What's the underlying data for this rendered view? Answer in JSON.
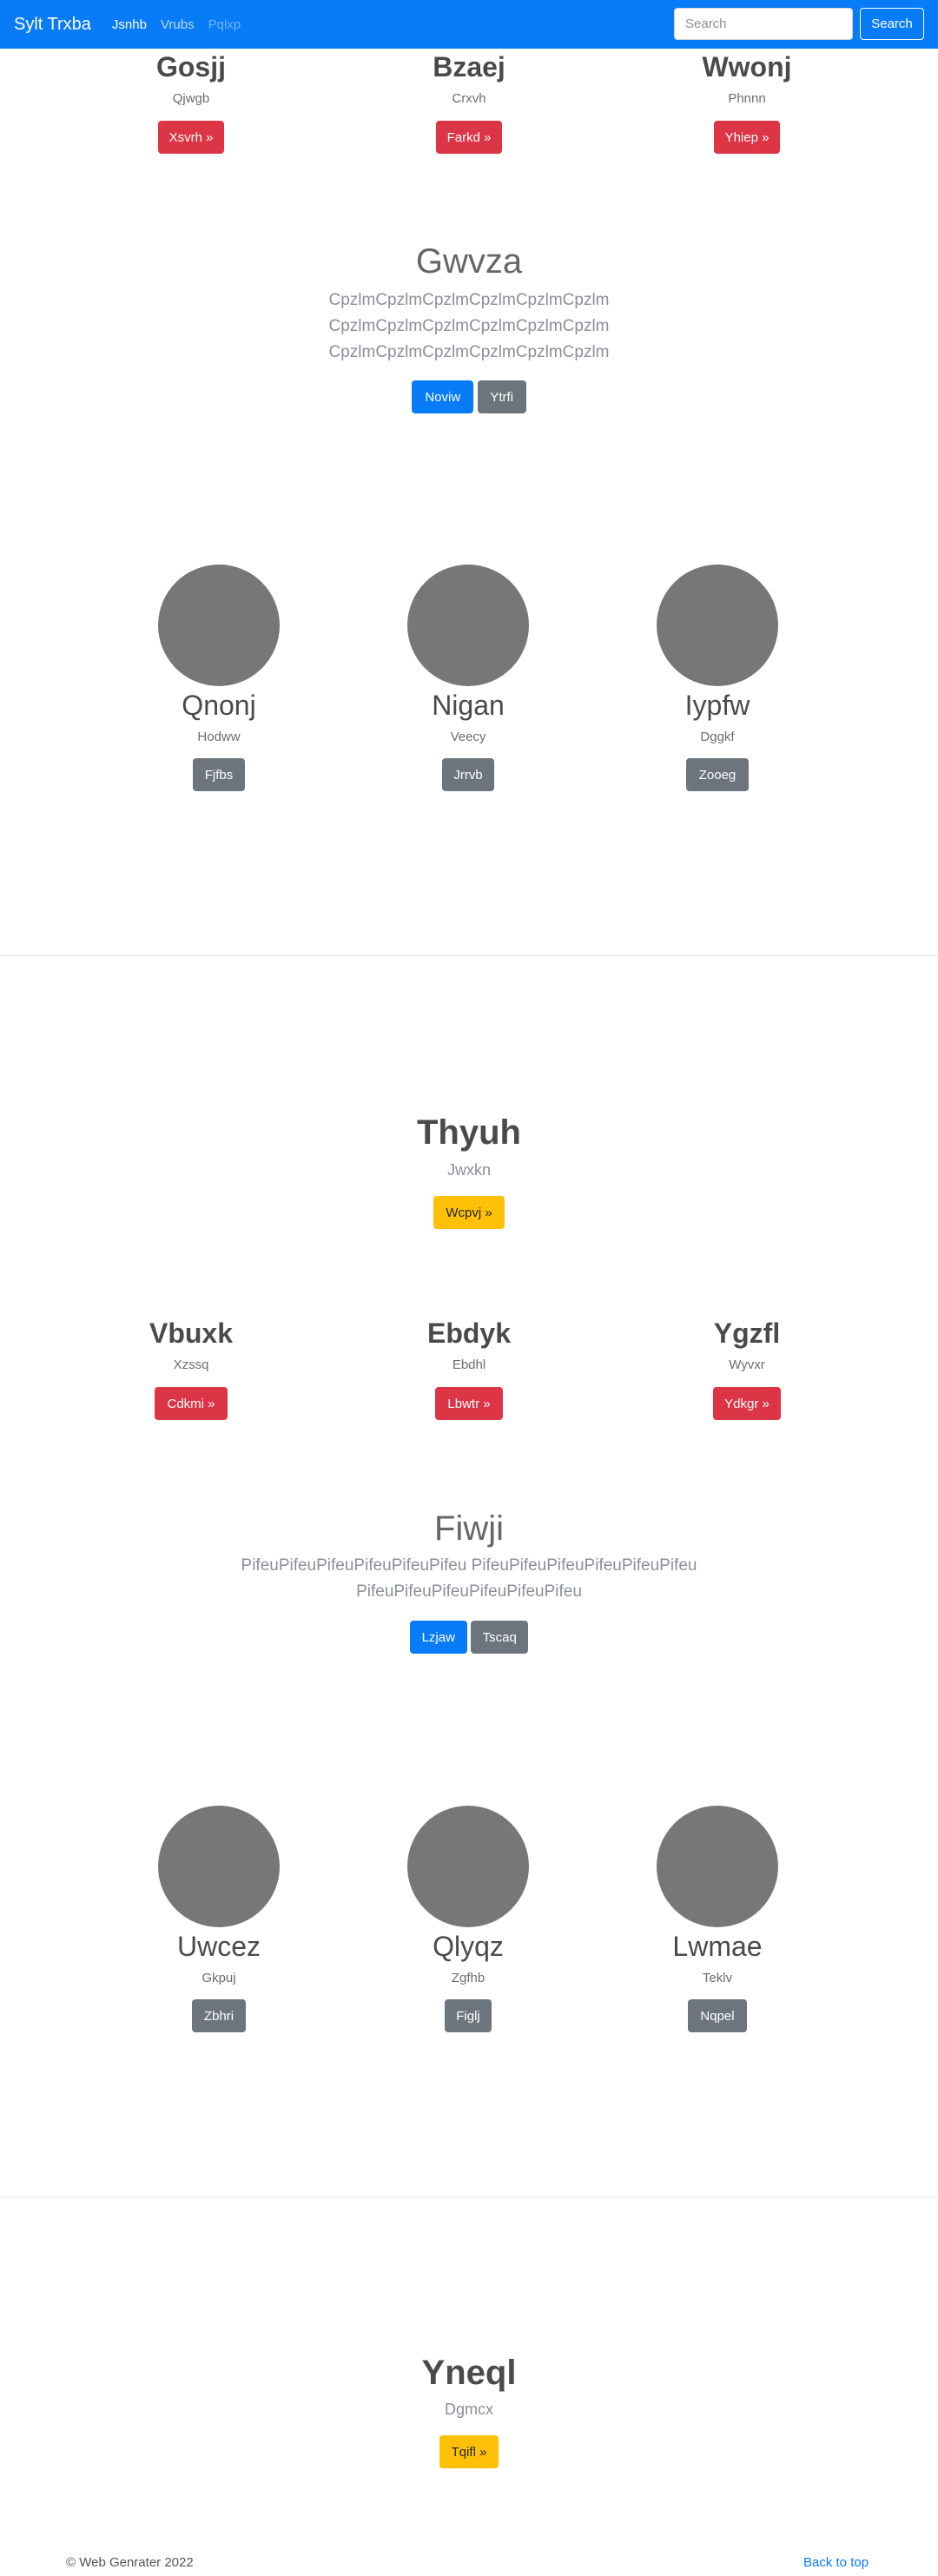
{
  "navbar": {
    "brand": "Sylt Trxba",
    "links": [
      "Jsnhb",
      "Vrubs",
      "Pqlxp"
    ],
    "search_placeholder": "Search",
    "search_button": "Search"
  },
  "cols1": [
    {
      "title": "Gosjj",
      "sub": "Qjwgb",
      "button": "Xsvrh »"
    },
    {
      "title": "Bzaej",
      "sub": "Crxvh",
      "button": "Farkd »"
    },
    {
      "title": "Wwonj",
      "sub": "Phnnn",
      "button": "Yhiep »"
    }
  ],
  "lead1": {
    "title": "Gwvza",
    "lines": [
      "CpzlmCpzlmCpzlmCpzlmCpzlmCpzlm",
      "CpzlmCpzlmCpzlmCpzlmCpzlmCpzlm",
      "CpzlmCpzlmCpzlmCpzlmCpzlmCpzlm"
    ],
    "primary": "Noviw",
    "secondary": "Ytrfi"
  },
  "circles1": [
    {
      "title": "Qnonj",
      "sub": "Hodww",
      "button": "Fjfbs"
    },
    {
      "title": "Nigan",
      "sub": "Veecy",
      "button": "Jrrvb"
    },
    {
      "title": "Iypfw",
      "sub": "Dggkf",
      "button": "Zooeg"
    }
  ],
  "hero1": {
    "title": "Thyuh",
    "sub": "Jwxkn",
    "button": "Wcpvj »"
  },
  "cols2": [
    {
      "title": "Vbuxk",
      "sub": "Xzssq",
      "button": "Cdkmi »"
    },
    {
      "title": "Ebdyk",
      "sub": "Ebdhl",
      "button": "Lbwtr »"
    },
    {
      "title": "Ygzfl",
      "sub": "Wyvxr",
      "button": "Ydkgr »"
    }
  ],
  "lead2": {
    "title": "Fiwji",
    "lines": [
      "PifeuPifeuPifeuPifeuPifeuPifeu PifeuPifeuPifeuPifeuPifeuPifeu",
      "PifeuPifeuPifeuPifeuPifeuPifeu"
    ],
    "primary": "Lzjaw",
    "secondary": "Tscaq"
  },
  "circles2": [
    {
      "title": "Uwcez",
      "sub": "Gkpuj",
      "button": "Zbhri"
    },
    {
      "title": "Qlyqz",
      "sub": "Zgfhb",
      "button": "Figlj"
    },
    {
      "title": "Lwmae",
      "sub": "Teklv",
      "button": "Nqpel"
    }
  ],
  "hero2": {
    "title": "Yneql",
    "sub": "Dgmcx",
    "button": "Tqifl »"
  },
  "footer": {
    "copyright": "© Web Genrater 2022",
    "back_to_top": "Back to top"
  },
  "colors": {
    "primary": "#087bf6",
    "danger": "#dc3545",
    "warning": "#ffc107",
    "secondary": "#6c757d",
    "placeholder_circle": "#777777"
  }
}
